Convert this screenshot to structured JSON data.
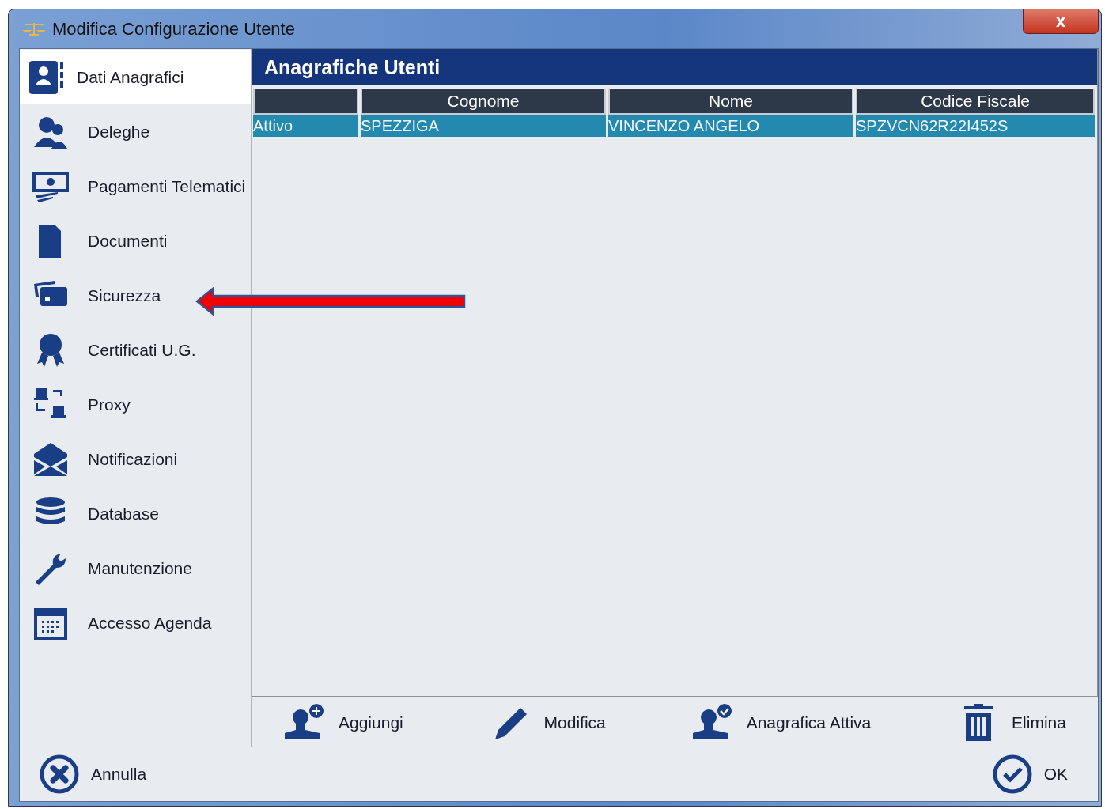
{
  "window": {
    "title": "Modifica Configurazione Utente",
    "close": "x"
  },
  "sidebar": {
    "items": [
      {
        "label": "Dati Anagrafici",
        "selected": true
      },
      {
        "label": "Deleghe",
        "selected": false
      },
      {
        "label": "Pagamenti Telematici",
        "selected": false
      },
      {
        "label": "Documenti",
        "selected": false
      },
      {
        "label": "Sicurezza",
        "selected": false
      },
      {
        "label": "Certificati U.G.",
        "selected": false
      },
      {
        "label": "Proxy",
        "selected": false
      },
      {
        "label": "Notificazioni",
        "selected": false
      },
      {
        "label": "Database",
        "selected": false
      },
      {
        "label": "Manutenzione",
        "selected": false
      },
      {
        "label": "Accesso Agenda",
        "selected": false
      }
    ]
  },
  "panel": {
    "title": "Anagrafiche Utenti"
  },
  "table": {
    "columns": [
      "",
      "Cognome",
      "Nome",
      "Codice Fiscale"
    ],
    "rows": [
      {
        "cells": [
          "Attivo",
          "SPEZZIGA",
          "VINCENZO ANGELO",
          "SPZVCN62R22I452S"
        ],
        "selected": true
      }
    ]
  },
  "toolbar": [
    "Aggiungi",
    "Modifica",
    "Anagrafica Attiva",
    "Elimina"
  ],
  "footer": {
    "cancel": "Annulla",
    "ok": "OK"
  },
  "annotation": {
    "kind": "arrow"
  }
}
